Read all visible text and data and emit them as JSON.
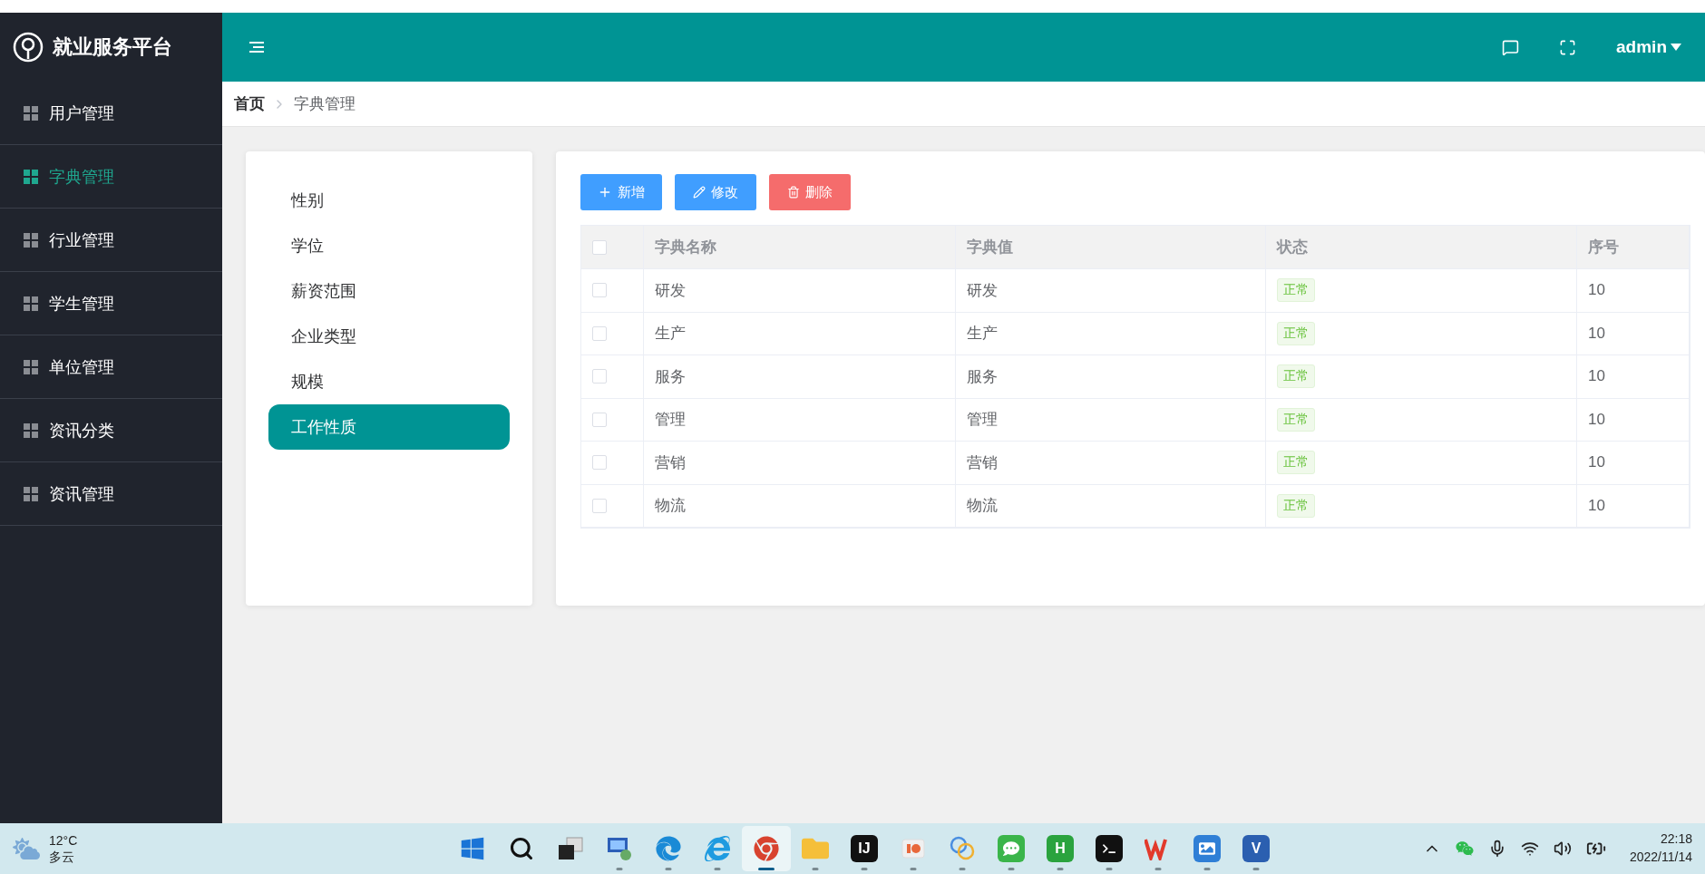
{
  "sidebar": {
    "title": "就业服务平台",
    "items": [
      {
        "label": "用户管理",
        "selected": false
      },
      {
        "label": "字典管理",
        "selected": true
      },
      {
        "label": "行业管理",
        "selected": false
      },
      {
        "label": "学生管理",
        "selected": false
      },
      {
        "label": "单位管理",
        "selected": false
      },
      {
        "label": "资讯分类",
        "selected": false
      },
      {
        "label": "资讯管理",
        "selected": false
      }
    ]
  },
  "header": {
    "user": "admin"
  },
  "breadcrumb": [
    "首页",
    "字典管理"
  ],
  "dict_types": [
    {
      "label": "性别",
      "selected": false
    },
    {
      "label": "学位",
      "selected": false
    },
    {
      "label": "薪资范围",
      "selected": false
    },
    {
      "label": "企业类型",
      "selected": false
    },
    {
      "label": "规模",
      "selected": false
    },
    {
      "label": "工作性质",
      "selected": true
    }
  ],
  "toolbar": [
    {
      "kind": "add",
      "label": "新增"
    },
    {
      "kind": "edit",
      "label": "修改"
    },
    {
      "kind": "delete",
      "label": "删除"
    }
  ],
  "table": {
    "header_checked": false,
    "columns": [
      "字典名称",
      "字典值",
      "状态",
      "序号"
    ],
    "rows": [
      {
        "checked": false,
        "name": "研发",
        "value": "研发",
        "status": "正常",
        "order": "10"
      },
      {
        "checked": false,
        "name": "生产",
        "value": "生产",
        "status": "正常",
        "order": "10"
      },
      {
        "checked": false,
        "name": "服务",
        "value": "服务",
        "status": "正常",
        "order": "10"
      },
      {
        "checked": false,
        "name": "管理",
        "value": "管理",
        "status": "正常",
        "order": "10"
      },
      {
        "checked": false,
        "name": "营销",
        "value": "营销",
        "status": "正常",
        "order": "10"
      },
      {
        "checked": false,
        "name": "物流",
        "value": "物流",
        "status": "正常",
        "order": "10"
      }
    ]
  },
  "taskbar": {
    "weather": {
      "temp": "12°C",
      "desc": "多云"
    },
    "apps": [
      {
        "kind": "start",
        "running": false,
        "selected": false
      },
      {
        "kind": "search",
        "running": false,
        "selected": false
      },
      {
        "kind": "taskview",
        "running": false,
        "selected": false
      },
      {
        "kind": "remote",
        "running": true,
        "selected": false
      },
      {
        "kind": "edge",
        "running": true,
        "selected": false
      },
      {
        "kind": "ie",
        "running": true,
        "selected": false
      },
      {
        "kind": "chrome",
        "running": true,
        "selected": true
      },
      {
        "kind": "folder",
        "running": true,
        "selected": false
      },
      {
        "kind": "ide",
        "label": "IJ",
        "running": true,
        "selected": false
      },
      {
        "kind": "slides",
        "running": true,
        "selected": false
      },
      {
        "kind": "db",
        "running": true,
        "selected": false
      },
      {
        "kind": "chat",
        "running": true,
        "selected": false
      },
      {
        "kind": "editor",
        "label": "H",
        "running": true,
        "selected": false
      },
      {
        "kind": "terminal",
        "running": true,
        "selected": false
      },
      {
        "kind": "office",
        "running": true,
        "selected": false
      },
      {
        "kind": "photos",
        "running": true,
        "selected": false
      },
      {
        "kind": "diagram",
        "label": "V",
        "running": true,
        "selected": false
      }
    ],
    "clock": {
      "time": "22:18",
      "date": "2022/11/14"
    }
  }
}
